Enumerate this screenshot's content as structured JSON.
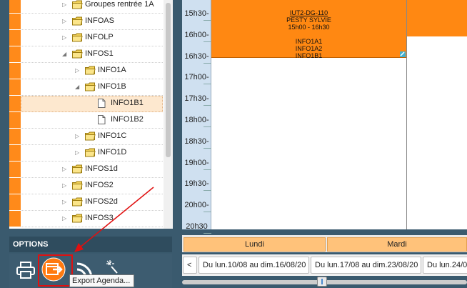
{
  "tree": {
    "rows": [
      {
        "label": "Groupes rentrée 1A",
        "type": "folder",
        "indent": 1,
        "expander": "collapsed"
      },
      {
        "label": "INFOAS",
        "type": "folder",
        "indent": 1,
        "expander": "collapsed"
      },
      {
        "label": "INFOLP",
        "type": "folder",
        "indent": 1,
        "expander": "collapsed"
      },
      {
        "label": "INFOS1",
        "type": "folder",
        "indent": 1,
        "expander": "expanded"
      },
      {
        "label": "INFO1A",
        "type": "folder",
        "indent": 2,
        "expander": "collapsed"
      },
      {
        "label": "INFO1B",
        "type": "folder",
        "indent": 2,
        "expander": "expanded"
      },
      {
        "label": "INFO1B1",
        "type": "file",
        "indent": 3,
        "expander": "none",
        "selected": true
      },
      {
        "label": "INFO1B2",
        "type": "file",
        "indent": 3,
        "expander": "none"
      },
      {
        "label": "INFO1C",
        "type": "folder",
        "indent": 2,
        "expander": "collapsed"
      },
      {
        "label": "INFO1D",
        "type": "folder",
        "indent": 2,
        "expander": "collapsed"
      },
      {
        "label": "INFOS1d",
        "type": "folder",
        "indent": 1,
        "expander": "collapsed"
      },
      {
        "label": "INFOS2",
        "type": "folder",
        "indent": 1,
        "expander": "collapsed"
      },
      {
        "label": "INFOS2d",
        "type": "folder",
        "indent": 1,
        "expander": "collapsed"
      },
      {
        "label": "INFOS3",
        "type": "folder",
        "indent": 1,
        "expander": "collapsed"
      }
    ]
  },
  "options": {
    "title": "OPTIONS",
    "icons": [
      "printer-icon",
      "export-agenda-icon",
      "rss-feed-icon",
      "magic-wand-icon"
    ],
    "tooltip": "Export Agenda..."
  },
  "schedule": {
    "times": [
      "15h30-",
      "16h00-",
      "16h30-",
      "17h00-",
      "17h30-",
      "18h00-",
      "18h30-",
      "19h00-",
      "19h30-",
      "20h00-",
      "20h30"
    ],
    "course": {
      "room": "IUT2-DG-110",
      "teacher": "PESTY SYLVIE",
      "hours": "15h00 - 16h30",
      "groups": [
        "INFO1A1",
        "INFO1A2",
        "INFO1B1"
      ]
    },
    "days": [
      "Lundi",
      "Mardi"
    ],
    "week_nav": {
      "prev_label": "<",
      "weeks": [
        "Du lun.10/08 au dim.16/08/20",
        "Du lun.17/08 au dim.23/08/20",
        "Du lun.24/08"
      ]
    }
  },
  "colors": {
    "accent_orange": "#ff8812",
    "tree_strip": "#ff8a1a",
    "options_bg": "#3d5c70",
    "time_column": "#cfe0f0",
    "annotation_red": "#e01010"
  }
}
